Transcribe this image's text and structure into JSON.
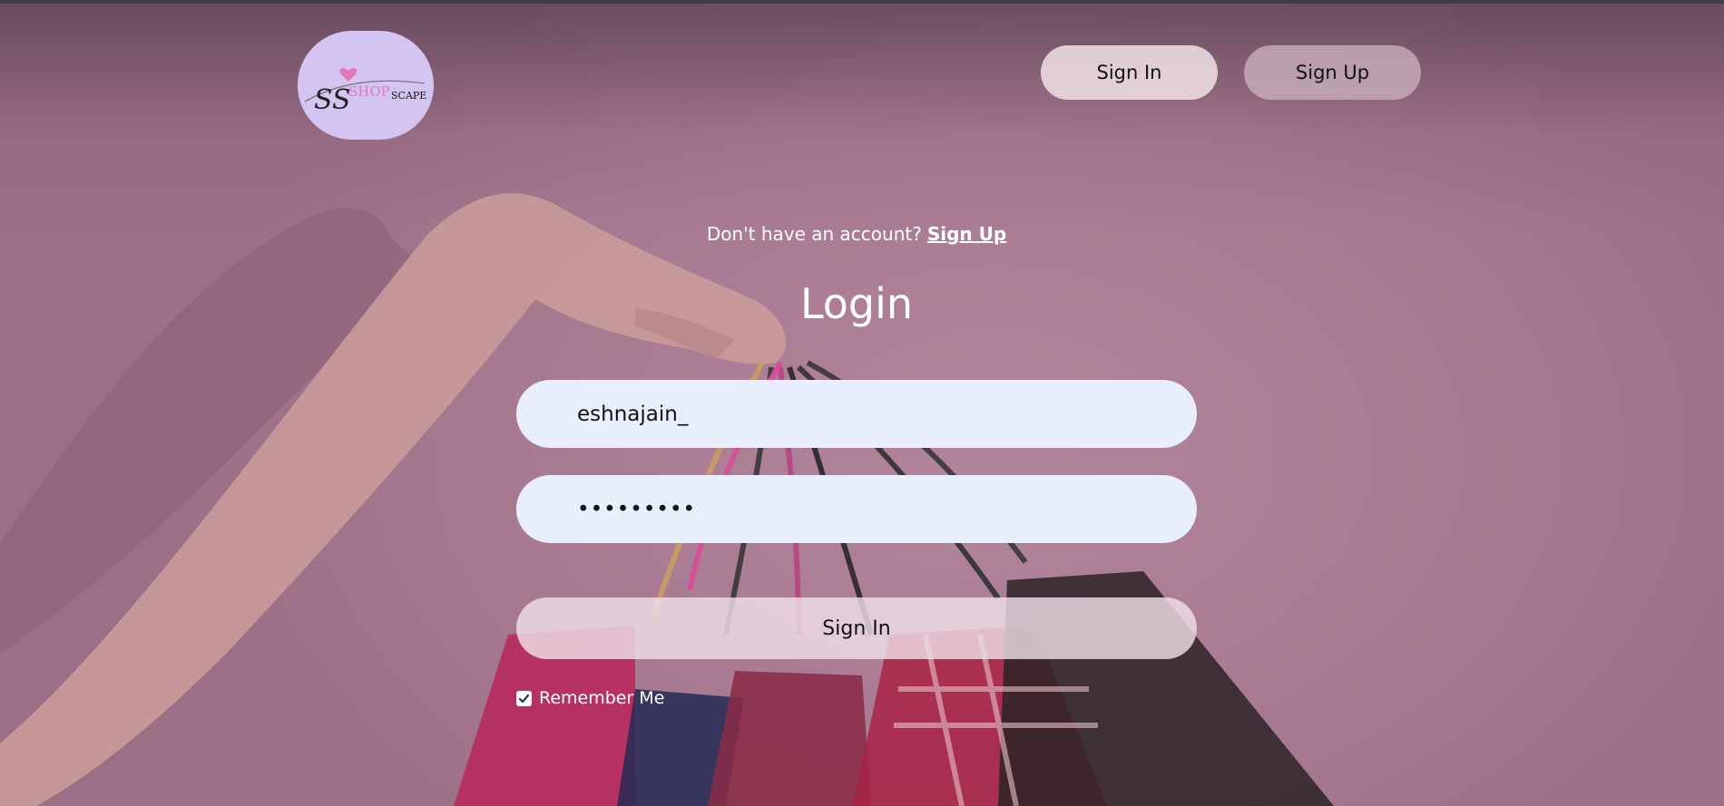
{
  "header": {
    "logo": {
      "mark": "SS",
      "word1": "SHOP",
      "word2": "SCAPE",
      "colors": {
        "badge": "#d4c4f2",
        "accent": "#e07bb8"
      }
    },
    "sign_in_label": "Sign In",
    "sign_up_label": "Sign Up"
  },
  "login": {
    "prompt": "Don't have an account?",
    "signup_link": "Sign Up",
    "title": "Login",
    "username_value": "eshnajain_",
    "password_value": "•••••••••",
    "submit_label": "Sign In",
    "remember_label": "Remember Me",
    "remember_checked": true
  },
  "colors": {
    "background": "#a87a91",
    "input_background": "#e8eefc",
    "text_light": "#ffffff"
  },
  "icons": {
    "checkbox": "check-icon"
  }
}
